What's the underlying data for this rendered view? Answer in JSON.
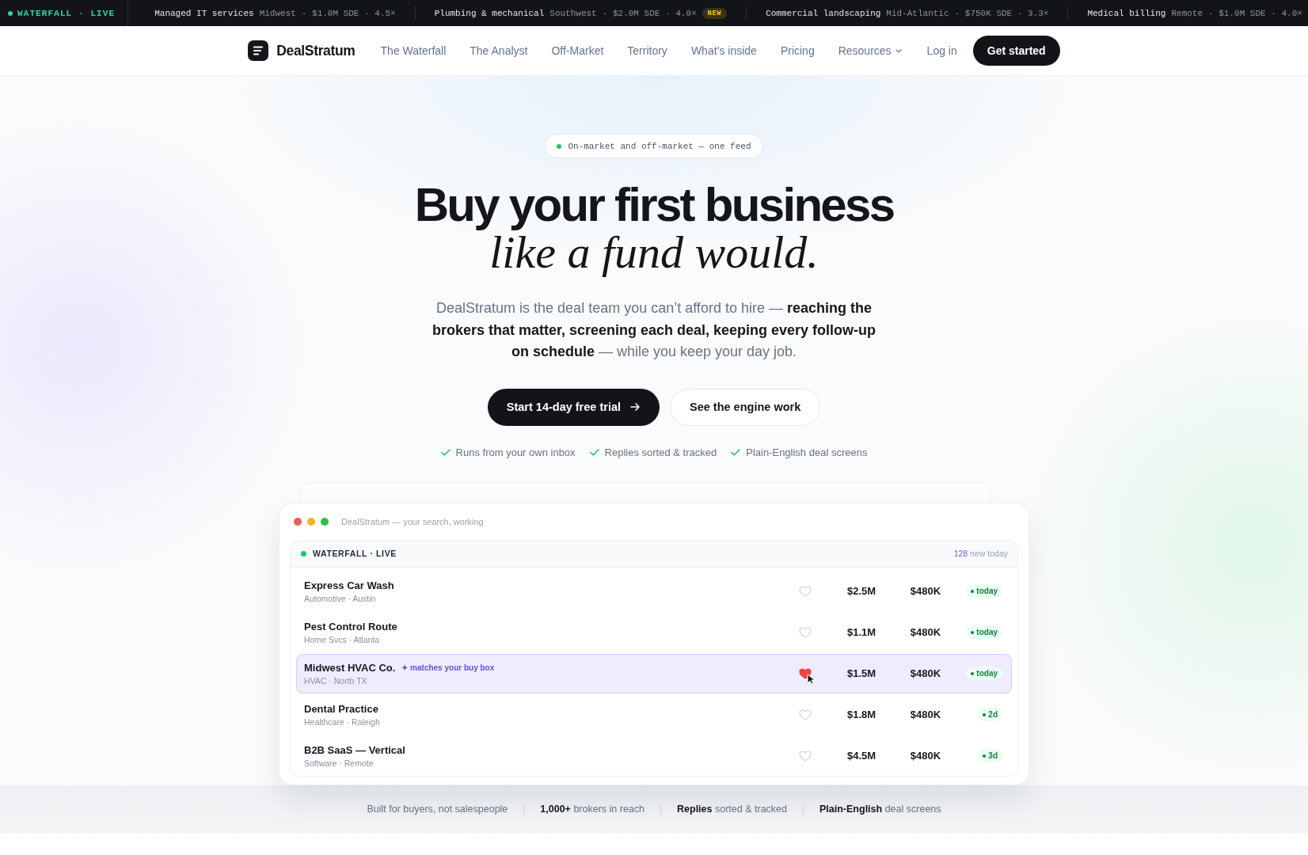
{
  "ticker": {
    "label": "WATERFALL · LIVE",
    "items": [
      {
        "name": "Managed IT services",
        "region": "Midwest",
        "meta": "· $1.0M SDE · 4.5×"
      },
      {
        "name": "Plumbing & mechanical",
        "region": "Southwest",
        "meta": "· $2.0M SDE · 4.0×",
        "badge": "NEW"
      },
      {
        "name": "Commercial landscaping",
        "region": "Mid-Atlantic",
        "meta": "· $750K SDE · 3.3×"
      },
      {
        "name": "Medical billing",
        "region": "Remote",
        "meta": "· $1.0M SDE · 4.0×"
      }
    ]
  },
  "nav": {
    "brand": "DealStratum",
    "links": [
      {
        "label": "The Waterfall",
        "kind": "link"
      },
      {
        "label": "The Analyst",
        "kind": "link"
      },
      {
        "label": "Off-Market",
        "kind": "link"
      },
      {
        "label": "Territory",
        "kind": "link"
      },
      {
        "label": "What’s inside",
        "kind": "link"
      },
      {
        "label": "Pricing",
        "kind": "link"
      },
      {
        "label": "Resources",
        "kind": "dropdown"
      }
    ],
    "login": "Log in",
    "cta": "Get started"
  },
  "hero": {
    "badge": "On-market and off-market — one feed",
    "title": "Buy your first business",
    "title_italic": "like a fund would.",
    "lead": "DealStratum is the deal team you can’t afford to hire — **reaching the brokers that matter, screening each deal, keeping every follow-up on schedule** — while you keep your day job.",
    "primary_button": "Start 14-day free trial",
    "secondary_button": "See the engine work",
    "checks": [
      "Runs from your own inbox",
      "Replies sorted & tracked",
      "Plain-English deal screens"
    ]
  },
  "preview": {
    "window_title": "DealStratum — your search, working",
    "feed_label": "WATERFALL · LIVE",
    "count": "128",
    "count_label": "new today",
    "rows": [
      {
        "name": "Express Car Wash",
        "meta": "Automotive · Austin",
        "price": "$2.5M",
        "sde": "$480K",
        "age": "today",
        "saved": false,
        "selected": false,
        "cursor": false
      },
      {
        "name": "Pest Control Route",
        "meta": "Home Svcs · Atlanta",
        "price": "$1.1M",
        "sde": "$480K",
        "age": "today",
        "saved": false,
        "selected": false,
        "cursor": false
      },
      {
        "name": "Midwest HVAC Co.",
        "tag": "✦ matches your buy box",
        "meta": "HVAC · North TX",
        "price": "$1.5M",
        "sde": "$480K",
        "age": "today",
        "saved": true,
        "selected": true,
        "cursor": true
      },
      {
        "name": "Dental Practice",
        "meta": "Healthcare · Raleigh",
        "price": "$1.8M",
        "sde": "$480K",
        "age": "2d",
        "saved": false,
        "selected": false,
        "cursor": false
      },
      {
        "name": "B2B SaaS — Vertical",
        "meta": "Software · Remote",
        "price": "$4.5M",
        "sde": "$480K",
        "age": "3d",
        "saved": false,
        "selected": false,
        "cursor": false
      }
    ]
  },
  "stats": [
    "Built for buyers, not salespeople",
    "**1,000+** brokers in reach",
    "**Replies** sorted & tracked",
    "**Plain-English** deal screens"
  ]
}
